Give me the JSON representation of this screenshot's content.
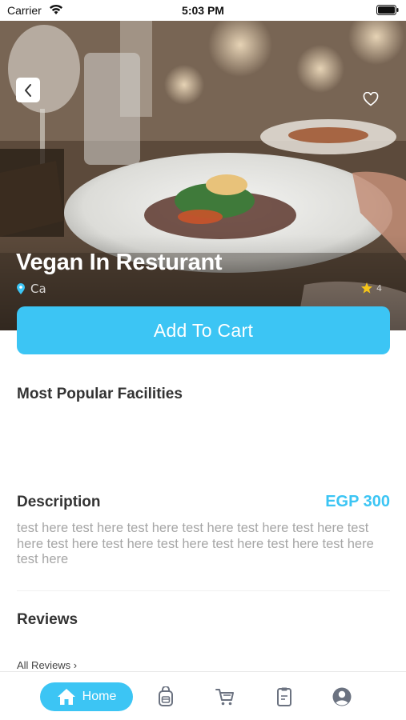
{
  "status_bar": {
    "carrier": "Carrier",
    "time": "5:03 PM"
  },
  "hero": {
    "title": "Vegan In Resturant",
    "location": "Ca",
    "rating": "4"
  },
  "actions": {
    "add_to_cart_label": "Add To Cart"
  },
  "sections": {
    "facilities_title": "Most Popular Facilities",
    "description_title": "Description",
    "price": "EGP 300",
    "description_text": "test here test here test here test here test here test here test here test here test here test here test here test here test here test here",
    "reviews_title": "Reviews",
    "all_reviews_label": "All Reviews ›"
  },
  "tab_bar": {
    "items": [
      {
        "label": "Home",
        "icon": "home-icon",
        "active": true
      },
      {
        "label": "",
        "icon": "backpack-icon",
        "active": false
      },
      {
        "label": "",
        "icon": "cart-icon",
        "active": false
      },
      {
        "label": "",
        "icon": "clipboard-icon",
        "active": false
      },
      {
        "label": "",
        "icon": "profile-icon",
        "active": false
      }
    ]
  },
  "colors": {
    "accent": "#3cc5f4",
    "text_dark": "#333333",
    "text_muted": "#a6a6a6"
  }
}
